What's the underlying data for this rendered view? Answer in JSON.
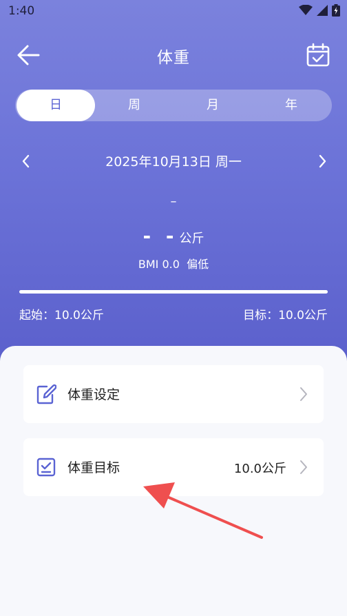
{
  "status_bar": {
    "time": "1:40"
  },
  "header": {
    "title": "体重"
  },
  "tabs": [
    {
      "label": "日",
      "active": true
    },
    {
      "label": "周",
      "active": false
    },
    {
      "label": "月",
      "active": false
    },
    {
      "label": "年",
      "active": false
    }
  ],
  "date": {
    "text": "2025年10月13日 周一"
  },
  "summary": {
    "top_dash": "–",
    "weight_value": "- -",
    "weight_unit": "公斤",
    "bmi_text": "BMI 0.0  偏低",
    "progress_fraction": 1.0,
    "start_label": "起始：10.0公斤",
    "target_label": "目标：10.0公斤"
  },
  "cards": {
    "setting": {
      "label": "体重设定"
    },
    "goal": {
      "label": "体重目标",
      "value": "10.0公斤"
    }
  },
  "colors": {
    "accent": "#5a63d3",
    "hero_top": "#7b82dd",
    "hero_bottom": "#5b60cc",
    "annotation_arrow": "#ef4f4f"
  }
}
